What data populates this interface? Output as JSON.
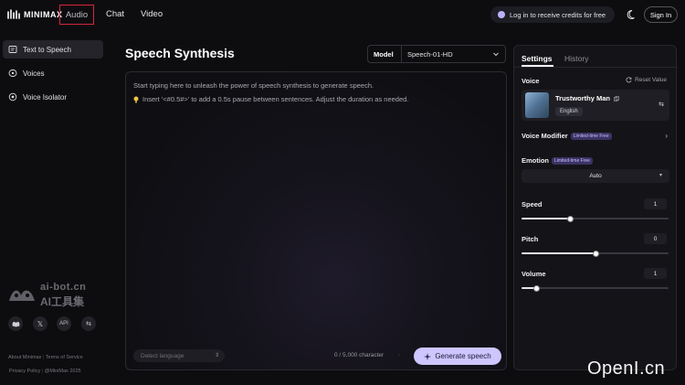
{
  "brand": {
    "name": "MINIMAX"
  },
  "nav": {
    "audio": "Audio",
    "chat": "Chat",
    "video": "Video"
  },
  "promo": {
    "label": "Log in to receive credits for free"
  },
  "signin": "Sign In",
  "sidebar": {
    "items": [
      {
        "label": "Text to Speech",
        "icon": "speech-icon",
        "active": true
      },
      {
        "label": "Voices",
        "icon": "voices-icon",
        "active": false
      },
      {
        "label": "Voice Isolator",
        "icon": "isolator-icon",
        "active": false
      }
    ],
    "watermark": {
      "line1": "ai-bot.cn",
      "line2": "AI工具集"
    },
    "social": {
      "discord": "discord-icon",
      "x": "x-icon",
      "api": "API",
      "extra": "toggle-icon"
    },
    "footer": {
      "about": "About Minimax",
      "terms": "Terms of Service",
      "privacy": "Privacy Policy",
      "copyright": "@MiniMax 2025"
    }
  },
  "main": {
    "title": "Speech Synthesis",
    "model": {
      "label": "Model",
      "value": "Speech-01-HD"
    },
    "editor": {
      "placeholder": "Start typing here to unleash the power of speech synthesis to generate speech.",
      "tip": "Insert '<#0.5#>' to add a 0.5s pause between sentences. Adjust the duration as needed."
    },
    "language_placeholder": "Detect language",
    "char_count": "0 / 5,000 character",
    "generate": "Generate speech"
  },
  "settings": {
    "tabs": [
      "Settings",
      "History"
    ],
    "voice": {
      "label": "Voice",
      "reset": "Reset Value",
      "name": "Trustworthy Man",
      "language": "English"
    },
    "voice_modifier": {
      "label": "Voice Modifier",
      "badge": "Limited-time Free"
    },
    "emotion": {
      "label": "Emotion",
      "badge": "Limited-time Free",
      "value": "Auto"
    },
    "speed": {
      "label": "Speed",
      "value": "1",
      "level": 0.33
    },
    "pitch": {
      "label": "Pitch",
      "value": "0",
      "level": 0.5
    },
    "volume": {
      "label": "Volume",
      "value": "1",
      "level": 0.1
    }
  },
  "overlay_watermark": "OpenI.cn"
}
